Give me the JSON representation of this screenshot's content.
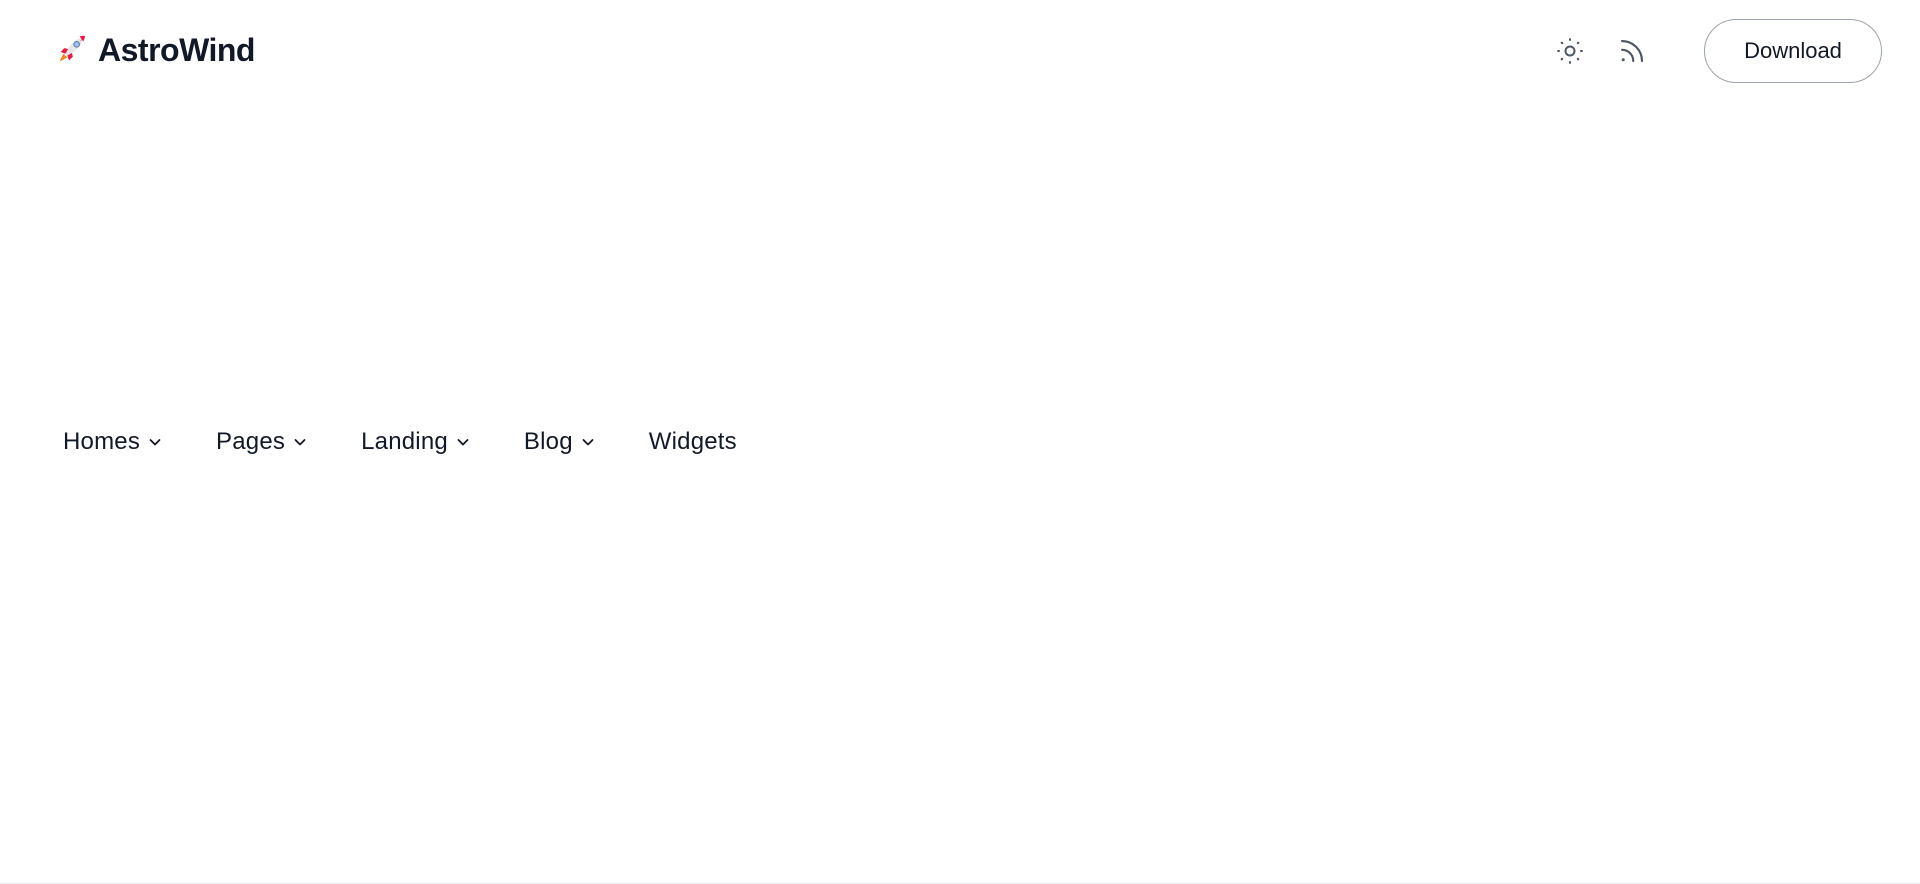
{
  "brand": {
    "name": "AstroWind",
    "logo_icon": "rocket-icon"
  },
  "header": {
    "theme_toggle_icon": "sun-icon",
    "rss_icon": "rss-icon",
    "download_label": "Download"
  },
  "nav": {
    "items": [
      {
        "label": "Homes",
        "has_dropdown": true
      },
      {
        "label": "Pages",
        "has_dropdown": true
      },
      {
        "label": "Landing",
        "has_dropdown": true
      },
      {
        "label": "Blog",
        "has_dropdown": true
      },
      {
        "label": "Widgets",
        "has_dropdown": false
      }
    ]
  },
  "colors": {
    "text": "#111827",
    "icon": "#6b7280",
    "button_border": "#9ca3af",
    "rocket_body": "#e5e7eb",
    "rocket_accent": "#e11d48",
    "rocket_flame": "#f97316",
    "background": "#ffffff"
  }
}
